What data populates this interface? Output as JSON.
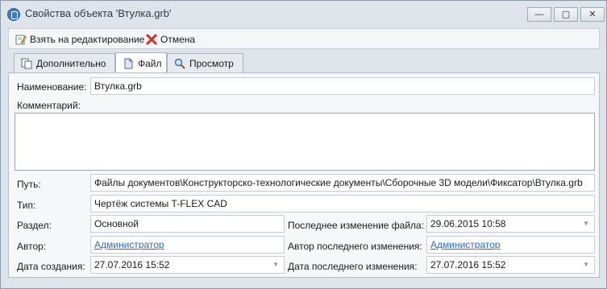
{
  "window": {
    "title": "Свойства объекта 'Втулка.grb'",
    "minimize_label": "—",
    "maximize_label": "▢",
    "close_label": "✕"
  },
  "toolbar": {
    "edit_label": "Взять на редактирование",
    "cancel_label": "Отмена"
  },
  "tabs": [
    {
      "label": "Дополнительно",
      "icon": "document-copy-icon",
      "active": false
    },
    {
      "label": "Файл",
      "icon": "file-icon",
      "active": true
    },
    {
      "label": "Просмотр",
      "icon": "magnifier-icon",
      "active": false
    }
  ],
  "form": {
    "name_label": "Наименование:",
    "name_value": "Втулка.grb",
    "comment_label": "Комментарий:",
    "comment_value": "",
    "path_label": "Путь:",
    "path_value": "Файлы документов\\Конструкторско-технологические документы\\Сборочные 3D модели\\Фиксатор\\Втулка.grb",
    "type_label": "Тип:",
    "type_value": "Чертёж системы T-FLEX CAD",
    "section_label": "Раздел:",
    "section_value": "Основной",
    "last_file_change_label": "Последнее изменение файла:",
    "last_file_change_value": "29.06.2015 10:58",
    "author_label": "Автор:",
    "author_value": "Администратор",
    "last_change_author_label": "Автор последнего изменения:",
    "last_change_author_value": "Администратор",
    "created_label": "Дата создания:",
    "created_value": "27.07.2016 15:52",
    "last_change_date_label": "Дата последнего изменения:",
    "last_change_date_value": "27.07.2016 15:52",
    "dropdown_glyph": "▼"
  },
  "colors": {
    "accent": "#3c7cc4",
    "link": "#2a6ad0",
    "cancel_red": "#d62b2b"
  }
}
